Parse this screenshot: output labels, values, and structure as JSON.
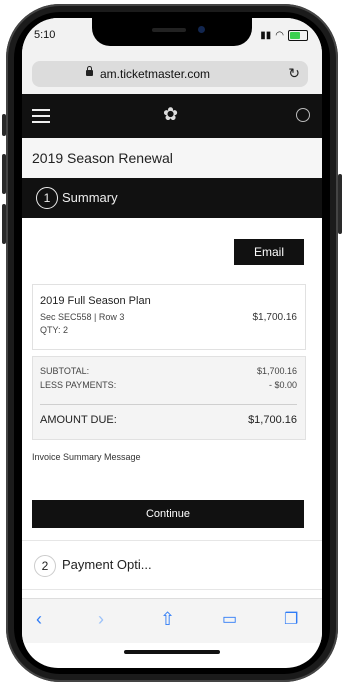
{
  "status": {
    "time": "5:10"
  },
  "browser": {
    "url": "am.ticketmaster.com"
  },
  "page": {
    "title": "2019 Season Renewal"
  },
  "step1": {
    "number": "1",
    "label": "Summary"
  },
  "actions": {
    "email": "Email",
    "continue": "Continue"
  },
  "plan": {
    "name": "2019 Full Season Plan",
    "seat": "Sec SEC558 | Row 3",
    "qty": "QTY: 2",
    "amount": "$1,700.16"
  },
  "totals": {
    "subtotal_label": "SUBTOTAL:",
    "subtotal_value": "$1,700.16",
    "payments_label": "LESS PAYMENTS:",
    "payments_value": "- $0.00",
    "due_label": "AMOUNT DUE:",
    "due_value": "$1,700.16"
  },
  "invoice_message": "Invoice Summary Message",
  "step2": {
    "number": "2",
    "label": "Payment Opti..."
  },
  "colors": {
    "accent": "#2f7cf6",
    "dark": "#111111"
  }
}
